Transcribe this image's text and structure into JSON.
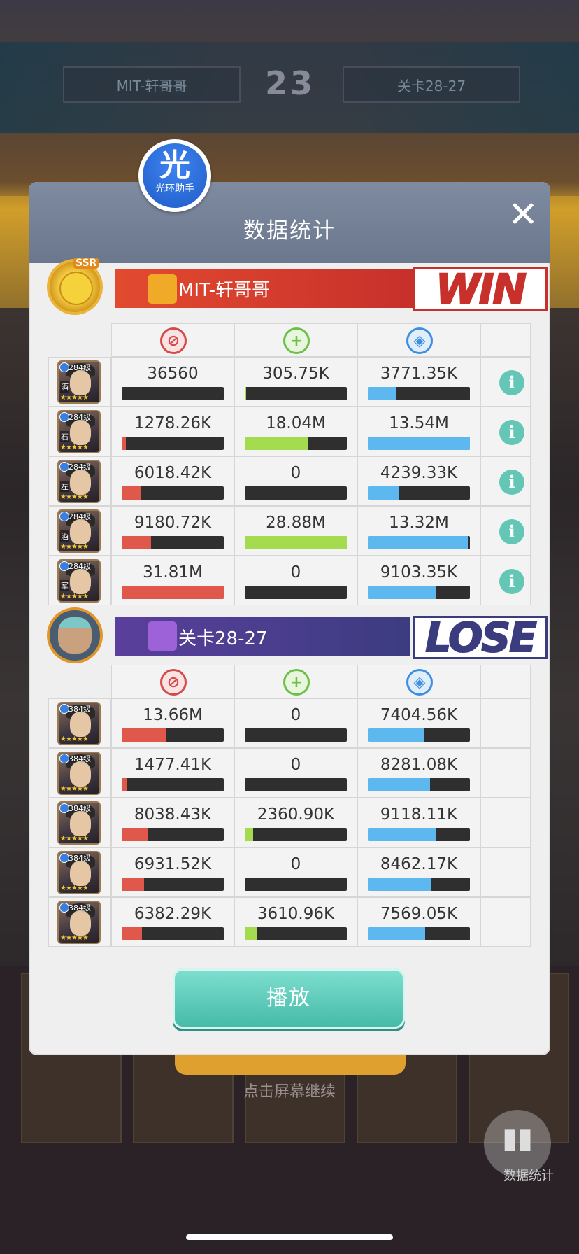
{
  "background": {
    "left_plate": "MIT-轩哥哥",
    "score": "23",
    "right_plate": "关卡28-27",
    "tap_hint": "点击屏幕继续",
    "stat_button_label": "数据统计"
  },
  "helper_badge": {
    "glyph": "光",
    "label": "光环助手"
  },
  "dialog": {
    "title": "数据统计",
    "close_icon": "close-icon",
    "play_label": "播放"
  },
  "team_win": {
    "name": "MIT-轩哥哥",
    "result": "WIN",
    "avatar_badge": "SSR",
    "color": "#c7302b",
    "heroes": [
      {
        "level": "284级",
        "tag": "酒",
        "damage": "36560",
        "damage_pct": 0.0011,
        "heal": "305.75K",
        "heal_pct": 0.011,
        "defense": "3771.35K",
        "defense_pct": 0.28
      },
      {
        "level": "284级",
        "tag": "石",
        "damage": "1278.26K",
        "damage_pct": 0.04,
        "heal": "18.04M",
        "heal_pct": 0.62,
        "defense": "13.54M",
        "defense_pct": 1.0
      },
      {
        "level": "284级",
        "tag": "左",
        "damage": "6018.42K",
        "damage_pct": 0.19,
        "heal": "0",
        "heal_pct": 0,
        "defense": "4239.33K",
        "defense_pct": 0.31
      },
      {
        "level": "284级",
        "tag": "酒",
        "damage": "9180.72K",
        "damage_pct": 0.29,
        "heal": "28.88M",
        "heal_pct": 1.0,
        "defense": "13.32M",
        "defense_pct": 0.98
      },
      {
        "level": "284级",
        "tag": "军",
        "damage": "31.81M",
        "damage_pct": 1.0,
        "heal": "0",
        "heal_pct": 0,
        "defense": "9103.35K",
        "defense_pct": 0.67
      }
    ]
  },
  "team_lose": {
    "name": "关卡28-27",
    "result": "LOSE",
    "color": "#3a3c7e",
    "heroes": [
      {
        "level": "384级",
        "damage": "13.66M",
        "damage_pct": 0.44,
        "heal": "0",
        "heal_pct": 0,
        "defense": "7404.56K",
        "defense_pct": 0.55
      },
      {
        "level": "384级",
        "damage": "1477.41K",
        "damage_pct": 0.05,
        "heal": "0",
        "heal_pct": 0,
        "defense": "8281.08K",
        "defense_pct": 0.61
      },
      {
        "level": "384级",
        "damage": "8038.43K",
        "damage_pct": 0.26,
        "heal": "2360.90K",
        "heal_pct": 0.08,
        "defense": "9118.11K",
        "defense_pct": 0.67
      },
      {
        "level": "384级",
        "damage": "6931.52K",
        "damage_pct": 0.22,
        "heal": "0",
        "heal_pct": 0,
        "defense": "8462.17K",
        "defense_pct": 0.62
      },
      {
        "level": "384级",
        "damage": "6382.29K",
        "damage_pct": 0.2,
        "heal": "3610.96K",
        "heal_pct": 0.125,
        "defense": "7569.05K",
        "defense_pct": 0.56
      }
    ]
  },
  "column_icons": [
    "sword-damage-icon",
    "heal-cross-icon",
    "shield-defense-icon"
  ],
  "colors": {
    "damage": "#e0584c",
    "heal": "#a5dc4f",
    "defense": "#5eb8f0",
    "info": "#64c7b5",
    "play": "#45b9a7"
  }
}
